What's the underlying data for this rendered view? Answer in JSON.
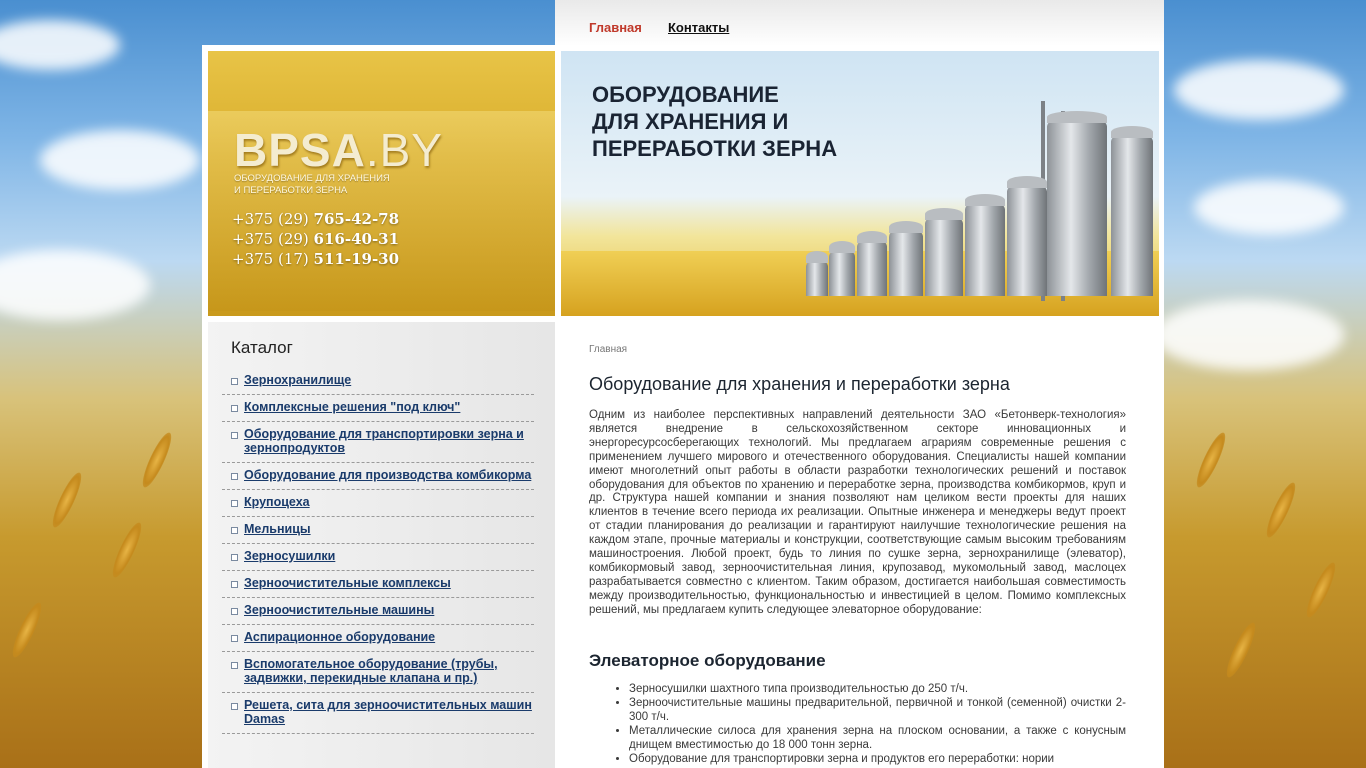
{
  "nav": {
    "home": "Главная",
    "contacts": "Контакты"
  },
  "logo": {
    "name": "BPSA",
    "domain": ".BY",
    "subtitle_line1": "ОБОРУДОВАНИЕ ДЛЯ ХРАНЕНИЯ",
    "subtitle_line2": "И ПЕРЕРАБОТКИ ЗЕРНА"
  },
  "phones": [
    {
      "prefix": "+375 (29) ",
      "number": "765-42-78"
    },
    {
      "prefix": "+375 (29) ",
      "number": "616-40-31"
    },
    {
      "prefix": "+375 (17) ",
      "number": "511-19-30"
    }
  ],
  "banner": {
    "line1": "ОБОРУДОВАНИЕ",
    "line2": "ДЛЯ ХРАНЕНИЯ И",
    "line3": "ПЕРЕРАБОТКИ ЗЕРНА"
  },
  "sidebar": {
    "title": "Каталог",
    "items": [
      "Зернохранилище",
      "Комплексные решения \"под ключ\"",
      "Оборудование для транспортировки зерна и зернопродуктов",
      "Оборудование для производства комбикорма",
      "Крупоцеха",
      "Мельницы",
      "Зерносушилки",
      "Зерноочистительные комплексы",
      "Зерноочистительные машины",
      "Аспирационное оборудование",
      "Вспомогательное оборудование (трубы, задвижки, перекидные клапана и пр.)",
      "Решета, сита для зерноочистительных машин Damas"
    ]
  },
  "content": {
    "breadcrumb": "Главная",
    "title": "Оборудование для хранения и переработки зерна",
    "intro": "Одним из наиболее перспективных направлений деятельности ЗАО «Бетонверк-технология» является внедрение в сельскохозяйственном секторе инновационных и энергоресурсосберегающих технологий. Мы предлагаем аграриям современные решения с применением лучшего мирового и отечественного оборудования. Специалисты нашей компании имеют многолетний опыт работы в области разработки технологических решений и поставок оборудования для объектов по хранению и переработке зерна, производства комбикормов, круп и др.   Структура нашей компании и знания позволяют нам целиком вести проекты для наших клиентов в течение всего периода их реализации. Опытные инженера и менеджеры ведут проект от стадии планирования до реализации и гарантируют наилучшие технологические решения на каждом этапе, прочные материалы и конструкции, соответствующие самым высоким требованиям машиностроения. Любой проект, будь то линия по сушке зерна, зернохранилище (элеватор), комбикормовый завод, зерноочистительная линия, крупозавод, мукомольный завод, маслоцех разрабатывается совместно с клиентом. Таким образом, достигается наибольшая совместимость между производительностью, функциональностью и инвестицией в целом. Помимо комплексных решений, мы предлагаем купить следующее элеваторное оборудование:",
    "subtitle": "Элеваторное оборудование",
    "bullets": [
      "Зерносушилки шахтного типа производительностью до 250 т/ч.",
      "Зерноочистительные машины предварительной, первичной и тонкой (семенной) очистки 2-300 т/ч.",
      "Металлические силоса для хранения зерна на плоском основании, а также с конусным днищем вместимостью до 18 000 тонн зерна.",
      "Оборудование для транспортировки зерна и продуктов его переработки: нории"
    ]
  }
}
